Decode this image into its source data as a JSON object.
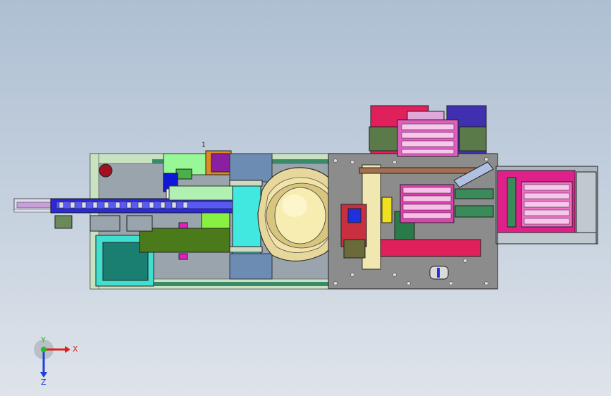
{
  "viewport": {
    "background_top": "#aebfd3",
    "background_bottom": "#dfe4ea"
  },
  "triad": {
    "x_label": "X",
    "y_label": "Y",
    "z_label": "Z",
    "x_color": "#e02020",
    "y_color": "#20c020",
    "z_color": "#2040e0"
  },
  "model": {
    "description_icon": "cad-assembly-top-view",
    "callout_marker": "1"
  }
}
